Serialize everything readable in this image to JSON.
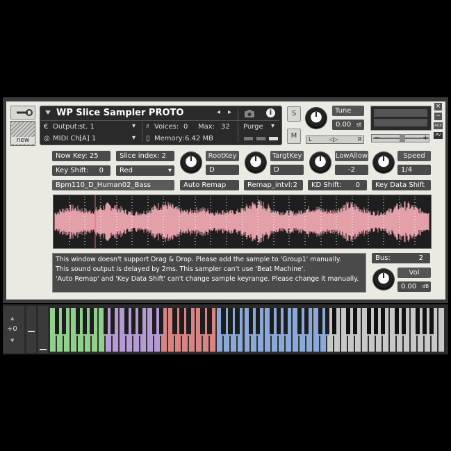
{
  "header": {
    "title": "WP Slice Sampler PROTO",
    "output_label": "Output:",
    "output_value": "st. 1",
    "midi_label": "MIDI Ch:",
    "midi_value": "[A]  1",
    "voices_label": "Voices:",
    "voices_value": "0",
    "max_label": "Max:",
    "max_value": "32",
    "memory_label": "Memory:",
    "memory_value": "6.42 MB",
    "purge_label": "Purge",
    "solo_label": "S",
    "mute_label": "M"
  },
  "tune": {
    "label": "Tune",
    "value": "0.00",
    "unit": "st"
  },
  "pan": {
    "left": "L",
    "right": "R",
    "center": "◁▷"
  },
  "right_panel": {
    "aux_label": "AUX",
    "pv_label": "PV",
    "minus": "−",
    "plus": "+"
  },
  "controls": {
    "now_key": "Now Key: 25",
    "slice_index_label": "Slice index:",
    "slice_index_value": "2",
    "key_shift_label": "Key Shift:",
    "key_shift_value": "0",
    "color_select": "Red",
    "sample_name": "Bpm110_D_Human02_Bass",
    "root_key_label": "RootKey",
    "root_key_value": "D",
    "target_key_label": "TargtKey",
    "target_key_value": "D",
    "low_allow_label": "LowAllow",
    "low_allow_value": "-2",
    "speed_label": "Speed",
    "speed_value": "1/4",
    "auto_remap": "Auto Remap",
    "remap_intvl_label": "Remap_intvl:",
    "remap_intvl_value": "2",
    "kd_shift_label": "KD Shift:",
    "kd_shift_value": "0",
    "key_data_shift": "Key Data Shift"
  },
  "message": {
    "line1": "This window doesn't support Drag & Drop. Please add the sample to 'Group1' manually.",
    "line2": "This sound output is delayed by 2ms. This sampler can't use 'Beat Machine'.",
    "line3": "'Auto Remap' and 'Key Data Shift' can't change sample keyrange. Please change it manually."
  },
  "bus": {
    "label": "Bus:",
    "value": "2"
  },
  "vol": {
    "label": "Vol",
    "value": "0.00",
    "unit": "dB"
  },
  "keyboard": {
    "octave_value": "+0",
    "zone_colors": [
      "#8fd08a",
      "#b59ad6",
      "#d98482",
      "#8aa8d8",
      "#c8c8c8"
    ],
    "zone_white_keys": [
      8,
      8,
      8,
      16,
      17
    ]
  },
  "colors": {
    "waveform": "#e3a0a8",
    "waveform_bg": "#1e1e1e",
    "panel": "#eae9e2"
  }
}
